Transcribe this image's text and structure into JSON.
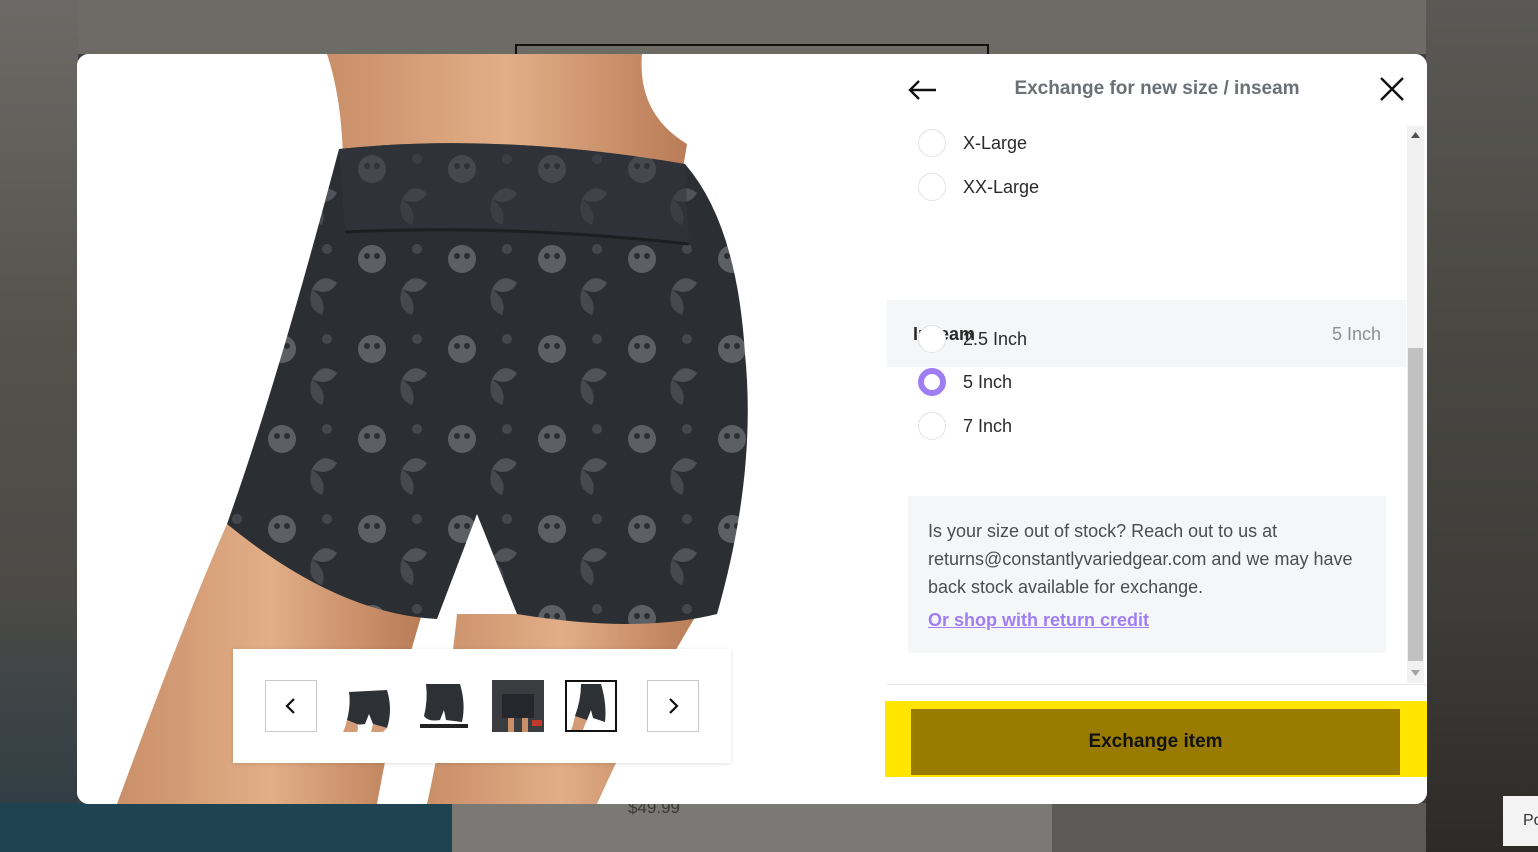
{
  "background": {
    "price": "$49.99",
    "corner_text": "Po"
  },
  "gallery": {
    "prev_icon": "chevron-left-icon",
    "next_icon": "chevron-right-icon",
    "thumbnails": [
      {
        "alt": "shorts-front"
      },
      {
        "alt": "shorts-side"
      },
      {
        "alt": "shorts-model"
      },
      {
        "alt": "shorts-back",
        "selected": true
      }
    ]
  },
  "panel": {
    "title": "Exchange for new size / inseam",
    "back_icon": "arrow-left-icon",
    "close_icon": "close-icon",
    "size_options": [
      {
        "label": "X-Large",
        "selected": false
      },
      {
        "label": "XX-Large",
        "selected": false
      }
    ],
    "inseam": {
      "heading": "Inseam",
      "selected_value": "5 Inch",
      "options": [
        {
          "label": "2.5 Inch",
          "selected": false
        },
        {
          "label": "5 Inch",
          "selected": true
        },
        {
          "label": "7 Inch",
          "selected": false
        }
      ]
    },
    "info": {
      "text": "Is your size out of stock? Reach out to us at returns@constantlyvariedgear.com and we may have back stock available for exchange.",
      "link": "Or shop with return credit"
    },
    "exchange_button": "Exchange item"
  },
  "colors": {
    "accent": "#9f7ef4",
    "button_bg": "#987b00",
    "highlight": "#ffe500"
  }
}
